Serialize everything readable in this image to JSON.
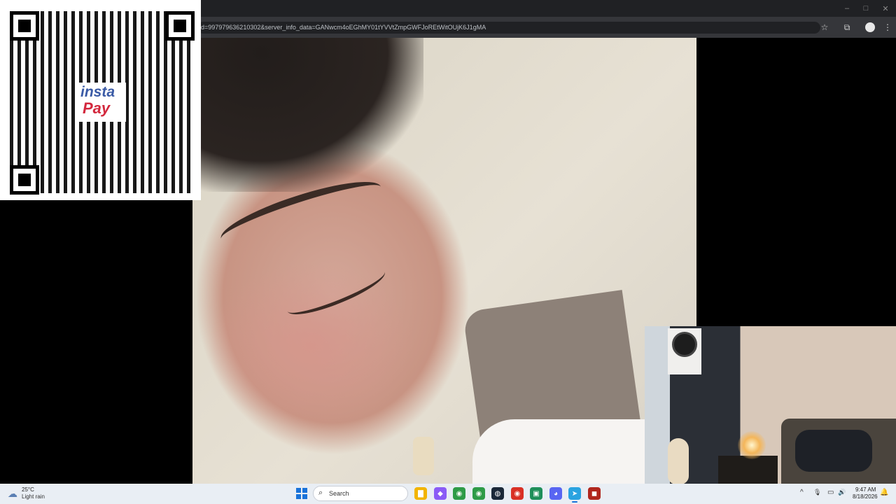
{
  "browser": {
    "url": "d=997979636210302&server_info_data=GANwcm4oEGhMY01tYVVtZmpGWFJoREtWitOUjK6J1gMA",
    "window_controls": {
      "minimize": "–",
      "maximize": "□",
      "close": "✕"
    },
    "icons": {
      "bookmark": "star-icon",
      "extensions": "puzzle-icon",
      "menu": "kebab-menu-icon"
    }
  },
  "overlay": {
    "qr_logo_top": "insta",
    "qr_logo_bottom": "Pay"
  },
  "taskbar": {
    "weather": {
      "temp": "25°C",
      "desc": "Light rain",
      "icon": "rain-cloud-icon"
    },
    "search_placeholder": "Search",
    "apps": [
      {
        "name": "file-explorer",
        "glyph": "▇",
        "color": "#f2b400"
      },
      {
        "name": "copilot",
        "glyph": "◆",
        "color": "#8a5cf6"
      },
      {
        "name": "chrome-1",
        "glyph": "◉",
        "color": "#2e9b47"
      },
      {
        "name": "chrome-2",
        "glyph": "◉",
        "color": "#2e9b47"
      },
      {
        "name": "steam",
        "glyph": "◍",
        "color": "#1b2838"
      },
      {
        "name": "chrome-3",
        "glyph": "◉",
        "color": "#d93025"
      },
      {
        "name": "game-app",
        "glyph": "▣",
        "color": "#1f8f5a"
      },
      {
        "name": "discord",
        "glyph": "◕",
        "color": "#5865f2"
      },
      {
        "name": "telegram",
        "glyph": "➤",
        "color": "#2aa3e0"
      },
      {
        "name": "dota",
        "glyph": "◼",
        "color": "#b0261d"
      }
    ],
    "tray": {
      "chevron": "^",
      "mic": "🎙",
      "display": "▭",
      "volume": "🔊"
    },
    "time": "9:47 AM",
    "date": "8/18/2026",
    "notification_icon": "🔔"
  }
}
